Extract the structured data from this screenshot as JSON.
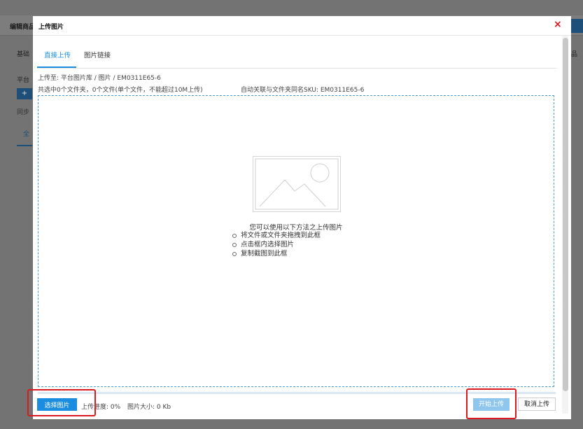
{
  "background": {
    "page_title": "编辑商品",
    "tab": "基础",
    "label": "平台",
    "add_button": "+",
    "text2": "同步",
    "tab2": "全",
    "right_text": "品"
  },
  "modal": {
    "title": "上传图片",
    "close_icon": "×",
    "tabs": [
      {
        "label": "直接上传",
        "active": true
      },
      {
        "label": "图片链接",
        "active": false
      }
    ],
    "upload_to": "上传至:  平台图片库 / 图片 / EM0311E65-6",
    "selection_info": "共选中0个文件夹，0个文件(单个文件，不能超过10M上传)",
    "sku_info": "自动关联与文件夹同名SKU: EM0311E65-6",
    "dropzone": {
      "icon": "image-placeholder-icon",
      "title": "您可以使用以下方法之上传图片",
      "methods": [
        "将文件或文件夹拖拽到此框",
        "点击框内选择图片",
        "复制截图到此框"
      ]
    },
    "footer": {
      "select_button": "选择图片",
      "progress": "上传进度: 0%",
      "size": "图片大小: 0 Kb",
      "start_button": "开始上传",
      "cancel_button": "取消上传"
    }
  },
  "colors": {
    "accent": "#1a8de0",
    "close": "#e0131a",
    "highlight": "#d91a1f",
    "start_disabled": "#8fc6ee"
  }
}
